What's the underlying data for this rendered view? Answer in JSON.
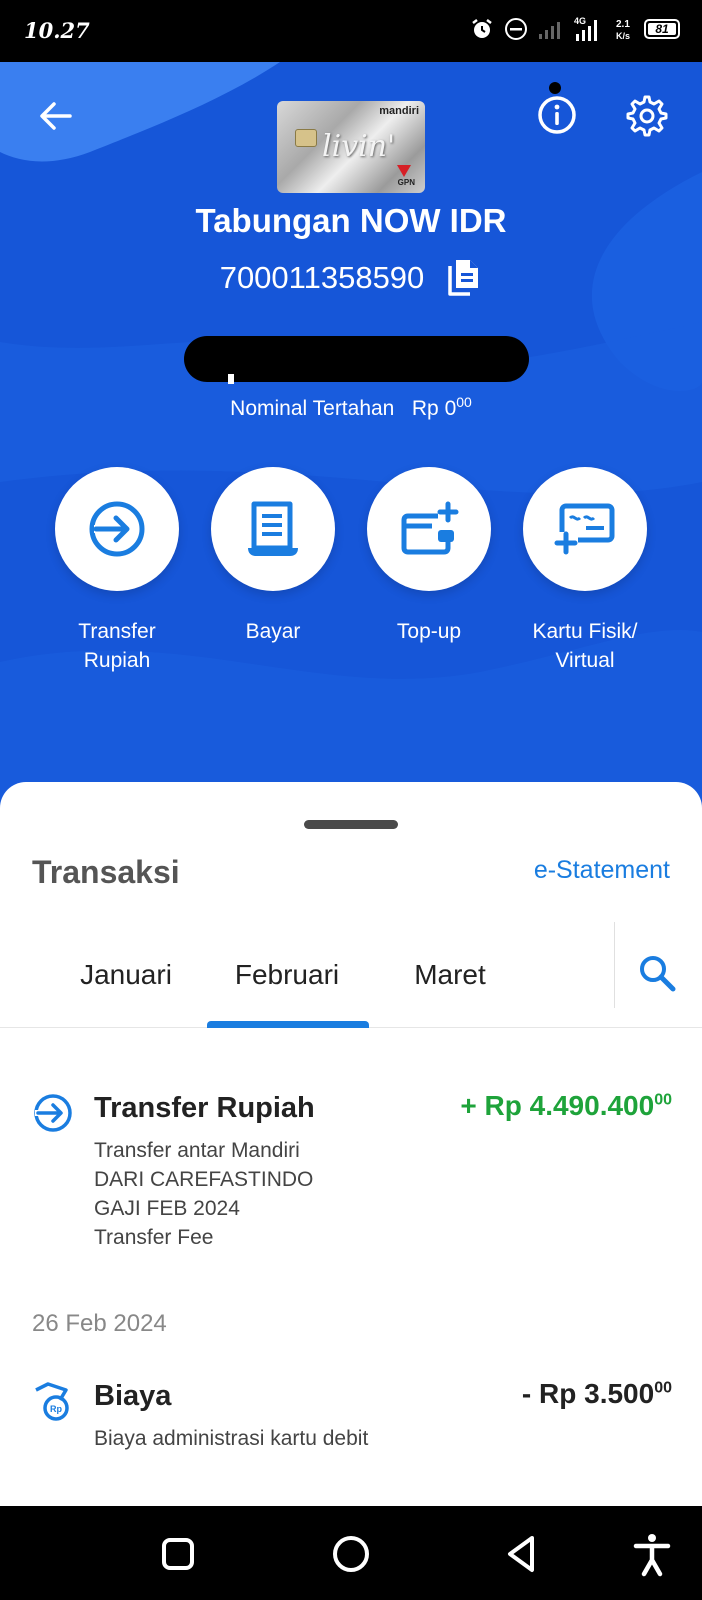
{
  "status_bar": {
    "time": "10.27",
    "battery": "81",
    "network_label": "4G"
  },
  "header": {
    "card": {
      "brand": "mandiri",
      "script": "livin'",
      "network": "GPN"
    },
    "account_name": "Tabungan NOW IDR",
    "account_number": "700011358590",
    "held_label": "Nominal Tertahan",
    "held_amount": "Rp 0",
    "held_cents": "00",
    "actions": [
      {
        "label_line1": "Transfer",
        "label_line2": "Rupiah"
      },
      {
        "label_line1": "Bayar",
        "label_line2": ""
      },
      {
        "label_line1": "Top-up",
        "label_line2": ""
      },
      {
        "label_line1": "Kartu Fisik/",
        "label_line2": "Virtual"
      }
    ]
  },
  "transactions": {
    "title": "Transaksi",
    "estatement_label": "e-Statement",
    "tabs": [
      "Januari",
      "Februari",
      "Maret"
    ],
    "active_tab": "Februari",
    "items": [
      {
        "title": "Transfer Rupiah",
        "amount": "+ Rp 4.490.400",
        "cents": "00",
        "amount_color": "#1ea33a",
        "lines": [
          "Transfer antar Mandiri",
          "DARI CAREFASTINDO",
          "GAJI FEB 2024",
          "Transfer Fee"
        ],
        "icon": "transfer-icon"
      },
      {
        "date": "26 Feb 2024",
        "title": "Biaya",
        "amount": "- Rp 3.500",
        "cents": "00",
        "amount_color": "#222222",
        "lines": [
          "Biaya administrasi kartu debit"
        ],
        "icon": "fee-icon"
      }
    ]
  },
  "colors": {
    "primary_blue": "#1656d8",
    "accent_blue": "#1a7de0",
    "credit_green": "#1ea33a"
  }
}
